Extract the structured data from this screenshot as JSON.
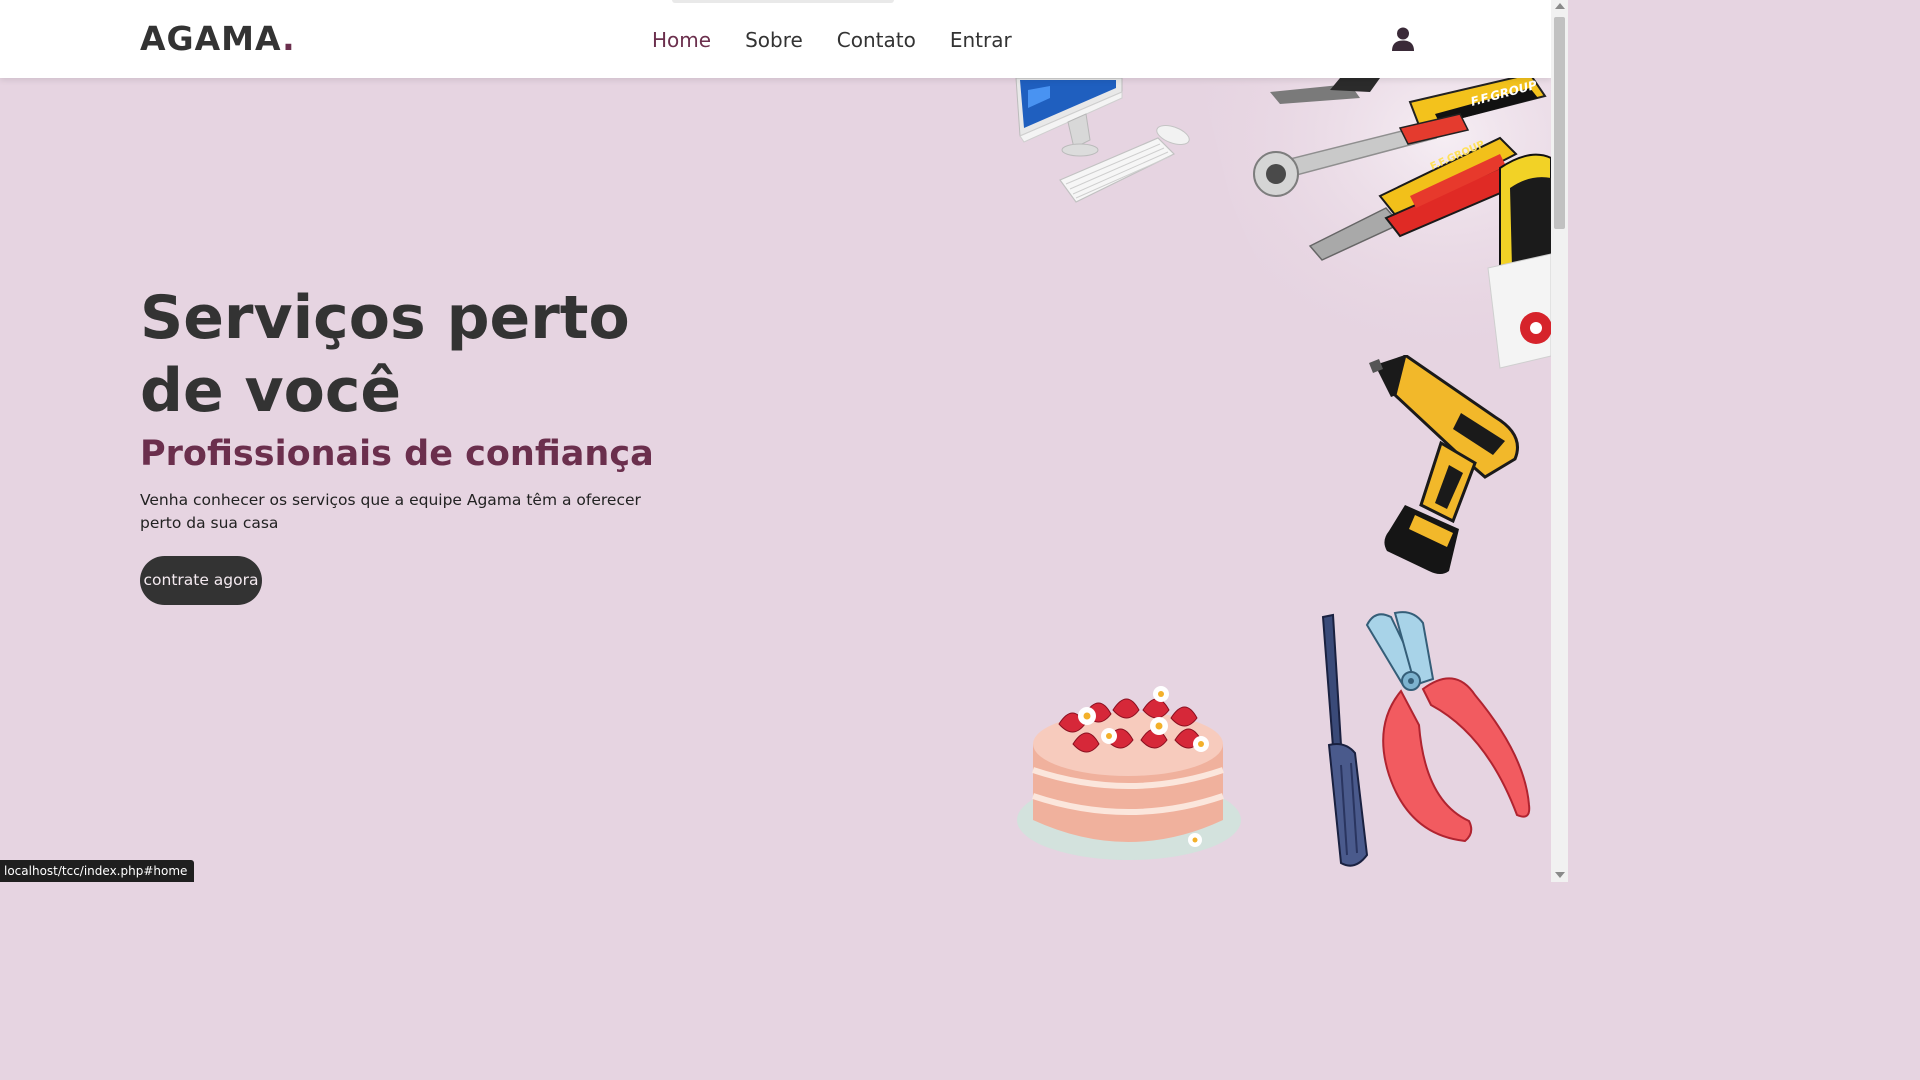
{
  "header": {
    "logo_text": "AGAMA",
    "logo_dot": ".",
    "nav": [
      {
        "label": "Home",
        "active": true
      },
      {
        "label": "Sobre",
        "active": false
      },
      {
        "label": "Contato",
        "active": false
      },
      {
        "label": "Entrar",
        "active": false
      }
    ],
    "user_icon": "user-icon"
  },
  "hero": {
    "title": "Serviços perto de você",
    "subtitle": "Profissionais de confiança",
    "description": "Venha conhecer os serviços que a equipe Agama têm a oferecer perto da sua casa",
    "cta_label": "contrate agora"
  },
  "illustrations": [
    "computer-keyboard-mouse",
    "tools-pliers-wrench",
    "cordless-drill",
    "strawberry-cake",
    "screwdriver-and-pliers"
  ],
  "status_bar": {
    "url": "localhost/tcc/index.php#home"
  },
  "colors": {
    "background": "#e6d4e1",
    "accent": "#6b2f4d",
    "text": "#333333",
    "header_bg": "#ffffff"
  }
}
